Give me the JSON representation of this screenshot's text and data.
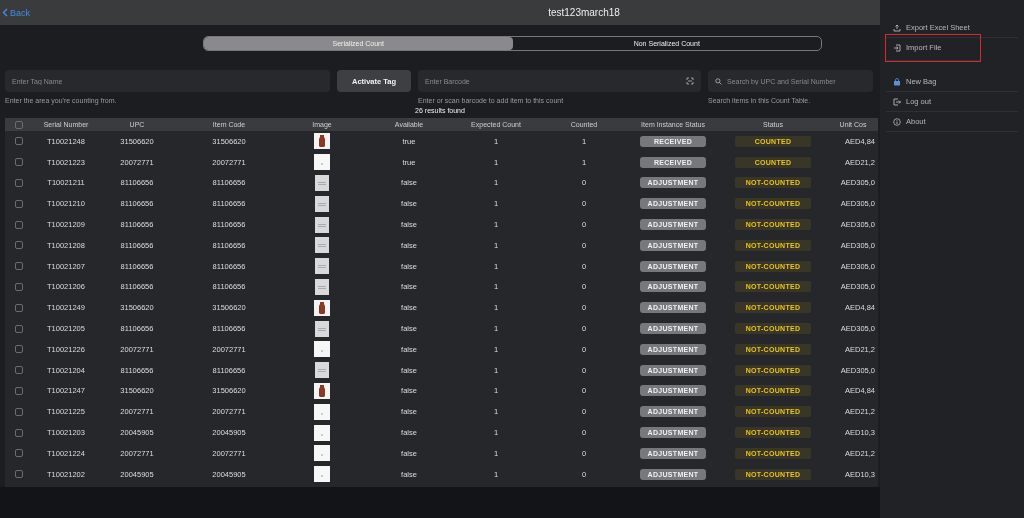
{
  "header": {
    "back_label": "Back",
    "title": "test123march18"
  },
  "segments": [
    {
      "label": "Serialized Count",
      "selected": true
    },
    {
      "label": "Non Serialized Count",
      "selected": false
    }
  ],
  "tag_field": {
    "placeholder": "Enter Tag Name",
    "hint": "Enter the area you're counting from."
  },
  "activate_button": "Activate Tag",
  "barcode_field": {
    "placeholder": "Enter Barcode",
    "hint": "Enter or scan barcode to add item to this count"
  },
  "search_field": {
    "placeholder": "Search by UPC and Serial Number",
    "hint": "Search items in this Count Table."
  },
  "results": "26 results found",
  "table": {
    "all_checked": false,
    "columns": [
      "Serial Number",
      "UPC",
      "Item Code",
      "Image",
      "Available",
      "Expected Count",
      "Counted",
      "Item Instance Status",
      "Status",
      "Unit Cos"
    ],
    "rows": [
      {
        "checked": false,
        "serial": "T10021248",
        "upc": "31506620",
        "item_code": "31506620",
        "kind": "vase",
        "available": "true",
        "expected": "1",
        "counted": "1",
        "instance_status": "RECEIVED",
        "status": "COUNTED",
        "unit_cost": "AED4,84"
      },
      {
        "checked": false,
        "serial": "T10021223",
        "upc": "20072771",
        "item_code": "20072771",
        "kind": "white",
        "available": "true",
        "expected": "1",
        "counted": "1",
        "instance_status": "RECEIVED",
        "status": "COUNTED",
        "unit_cost": "AED21,2"
      },
      {
        "checked": false,
        "serial": "T10021211",
        "upc": "81106656",
        "item_code": "81106656",
        "kind": "grey",
        "available": "false",
        "expected": "1",
        "counted": "0",
        "instance_status": "ADJUSTMENT",
        "status": "NOT-COUNTED",
        "unit_cost": "AED305,0"
      },
      {
        "checked": false,
        "serial": "T10021210",
        "upc": "81106656",
        "item_code": "81106656",
        "kind": "grey",
        "available": "false",
        "expected": "1",
        "counted": "0",
        "instance_status": "ADJUSTMENT",
        "status": "NOT-COUNTED",
        "unit_cost": "AED305,0"
      },
      {
        "checked": false,
        "serial": "T10021209",
        "upc": "81106656",
        "item_code": "81106656",
        "kind": "grey",
        "available": "false",
        "expected": "1",
        "counted": "0",
        "instance_status": "ADJUSTMENT",
        "status": "NOT-COUNTED",
        "unit_cost": "AED305,0"
      },
      {
        "checked": false,
        "serial": "T10021208",
        "upc": "81106656",
        "item_code": "81106656",
        "kind": "grey",
        "available": "false",
        "expected": "1",
        "counted": "0",
        "instance_status": "ADJUSTMENT",
        "status": "NOT-COUNTED",
        "unit_cost": "AED305,0"
      },
      {
        "checked": false,
        "serial": "T10021207",
        "upc": "81106656",
        "item_code": "81106656",
        "kind": "grey",
        "available": "false",
        "expected": "1",
        "counted": "0",
        "instance_status": "ADJUSTMENT",
        "status": "NOT-COUNTED",
        "unit_cost": "AED305,0"
      },
      {
        "checked": false,
        "serial": "T10021206",
        "upc": "81106656",
        "item_code": "81106656",
        "kind": "grey",
        "available": "false",
        "expected": "1",
        "counted": "0",
        "instance_status": "ADJUSTMENT",
        "status": "NOT-COUNTED",
        "unit_cost": "AED305,0"
      },
      {
        "checked": false,
        "serial": "T10021249",
        "upc": "31506620",
        "item_code": "31506620",
        "kind": "vase",
        "available": "false",
        "expected": "1",
        "counted": "0",
        "instance_status": "ADJUSTMENT",
        "status": "NOT-COUNTED",
        "unit_cost": "AED4,84"
      },
      {
        "checked": false,
        "serial": "T10021205",
        "upc": "81106656",
        "item_code": "81106656",
        "kind": "grey",
        "available": "false",
        "expected": "1",
        "counted": "0",
        "instance_status": "ADJUSTMENT",
        "status": "NOT-COUNTED",
        "unit_cost": "AED305,0"
      },
      {
        "checked": false,
        "serial": "T10021226",
        "upc": "20072771",
        "item_code": "20072771",
        "kind": "white",
        "available": "false",
        "expected": "1",
        "counted": "0",
        "instance_status": "ADJUSTMENT",
        "status": "NOT-COUNTED",
        "unit_cost": "AED21,2"
      },
      {
        "checked": false,
        "serial": "T10021204",
        "upc": "81106656",
        "item_code": "81106656",
        "kind": "grey",
        "available": "false",
        "expected": "1",
        "counted": "0",
        "instance_status": "ADJUSTMENT",
        "status": "NOT-COUNTED",
        "unit_cost": "AED305,0"
      },
      {
        "checked": false,
        "serial": "T10021247",
        "upc": "31506620",
        "item_code": "31506620",
        "kind": "vase",
        "available": "false",
        "expected": "1",
        "counted": "0",
        "instance_status": "ADJUSTMENT",
        "status": "NOT-COUNTED",
        "unit_cost": "AED4,84"
      },
      {
        "checked": false,
        "serial": "T10021225",
        "upc": "20072771",
        "item_code": "20072771",
        "kind": "white",
        "available": "false",
        "expected": "1",
        "counted": "0",
        "instance_status": "ADJUSTMENT",
        "status": "NOT-COUNTED",
        "unit_cost": "AED21,2"
      },
      {
        "checked": false,
        "serial": "T10021203",
        "upc": "20045905",
        "item_code": "20045905",
        "kind": "white",
        "available": "false",
        "expected": "1",
        "counted": "0",
        "instance_status": "ADJUSTMENT",
        "status": "NOT-COUNTED",
        "unit_cost": "AED10,3"
      },
      {
        "checked": false,
        "serial": "T10021224",
        "upc": "20072771",
        "item_code": "20072771",
        "kind": "white",
        "available": "false",
        "expected": "1",
        "counted": "0",
        "instance_status": "ADJUSTMENT",
        "status": "NOT-COUNTED",
        "unit_cost": "AED21,2"
      },
      {
        "checked": false,
        "serial": "T10021202",
        "upc": "20045905",
        "item_code": "20045905",
        "kind": "white",
        "available": "false",
        "expected": "1",
        "counted": "0",
        "instance_status": "ADJUSTMENT",
        "status": "NOT-COUNTED",
        "unit_cost": "AED10,3"
      }
    ]
  },
  "menu_groups": [
    [
      {
        "label": "Export Excel Sheet",
        "kind": "export",
        "highlighted": false
      },
      {
        "label": "Import File",
        "kind": "import",
        "highlighted": true
      }
    ],
    [
      {
        "label": "New Bag",
        "kind": "bag",
        "highlighted": false
      },
      {
        "label": "Log out",
        "kind": "logout",
        "highlighted": false
      },
      {
        "label": "About",
        "kind": "info",
        "highlighted": false
      }
    ]
  ]
}
